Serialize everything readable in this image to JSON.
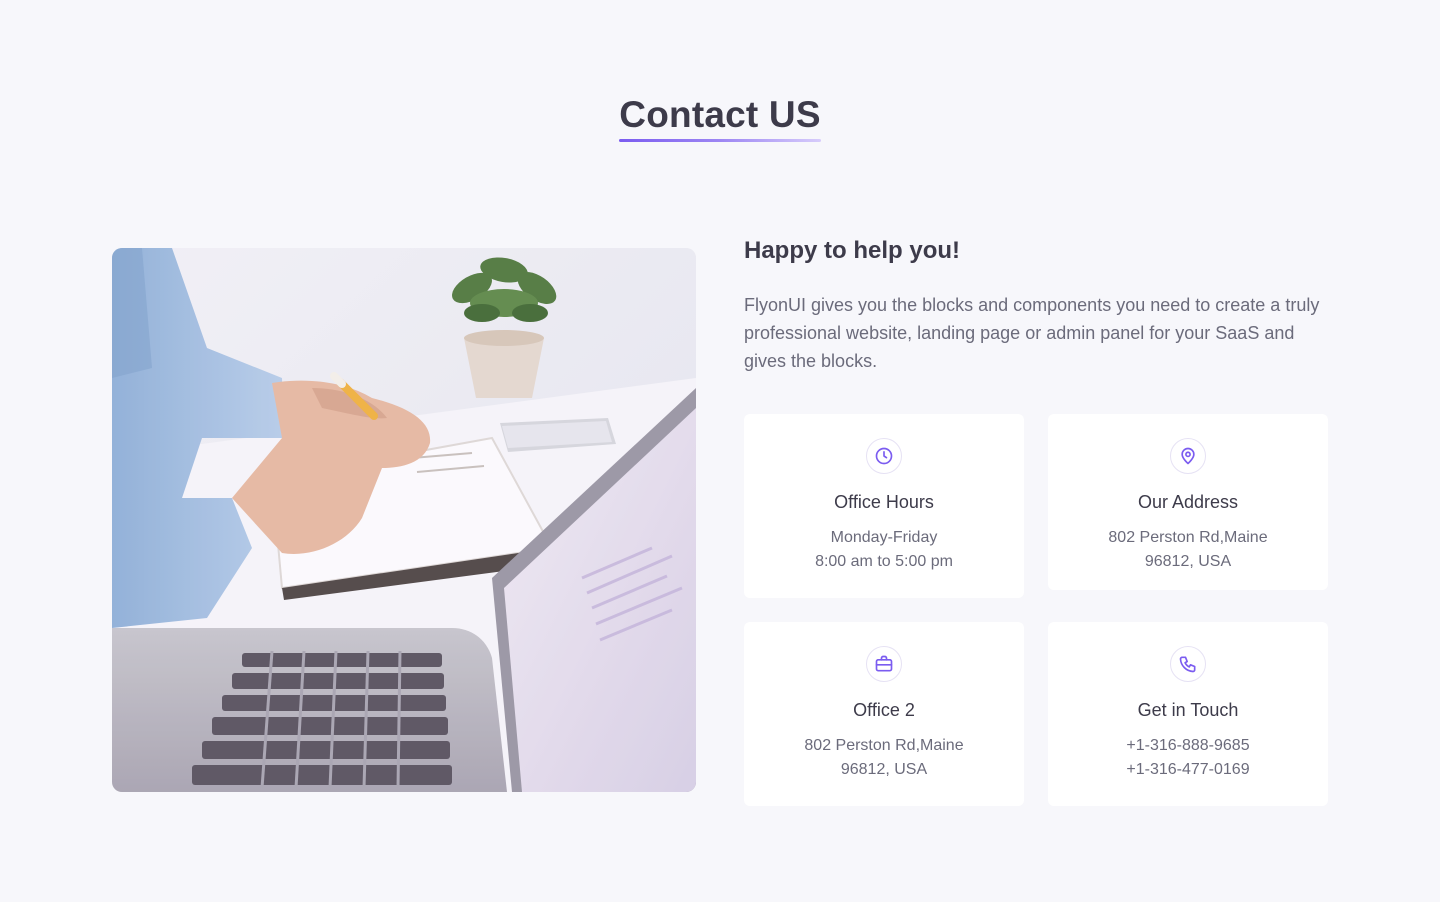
{
  "page": {
    "title": "Contact US",
    "accent_color": "#7b5cf0"
  },
  "hero_image": {
    "alt": "Person writing in a notebook next to a laptop"
  },
  "intro": {
    "heading": "Happy to help you!",
    "description": "FlyonUI gives you the blocks and components you need to create a truly professional website, landing page or admin panel for your SaaS and gives the blocks."
  },
  "cards": [
    {
      "icon": "clock-icon",
      "title": "Office Hours",
      "line1": "Monday-Friday",
      "line2": "8:00 am to 5:00 pm"
    },
    {
      "icon": "map-pin-icon",
      "title": "Our Address",
      "line1": "802 Perston Rd,Maine",
      "line2": "96812, USA"
    },
    {
      "icon": "briefcase-icon",
      "title": "Office 2",
      "line1": "802 Perston Rd,Maine",
      "line2": "96812, USA"
    },
    {
      "icon": "phone-icon",
      "title": "Get in Touch",
      "line1": "+1-316-888-9685",
      "line2": "+1-316-477-0169"
    }
  ]
}
